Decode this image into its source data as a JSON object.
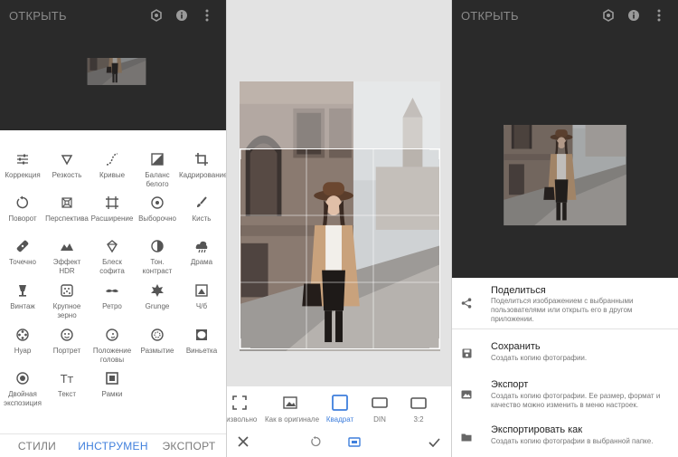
{
  "left_panel": {
    "title": "ОТКРЫТЬ",
    "tools": [
      {
        "icon": "sliders-icon",
        "label": "Коррекция"
      },
      {
        "icon": "triangle-down-icon",
        "label": "Резкость"
      },
      {
        "icon": "curves-icon",
        "label": "Кривые"
      },
      {
        "icon": "white-balance-icon",
        "label": "Баланс белого"
      },
      {
        "icon": "crop-icon",
        "label": "Кадрирование"
      },
      {
        "icon": "rotate-icon",
        "label": "Поворот"
      },
      {
        "icon": "perspective-icon",
        "label": "Перспектива"
      },
      {
        "icon": "expand-icon",
        "label": "Расширение"
      },
      {
        "icon": "selective-icon",
        "label": "Выборочно"
      },
      {
        "icon": "brush-icon",
        "label": "Кисть"
      },
      {
        "icon": "healing-icon",
        "label": "Точечно"
      },
      {
        "icon": "hdr-icon",
        "label": "Эффект HDR"
      },
      {
        "icon": "glamour-icon",
        "label": "Блеск софита"
      },
      {
        "icon": "tonal-icon",
        "label": "Тон. контраст"
      },
      {
        "icon": "drama-icon",
        "label": "Драма"
      },
      {
        "icon": "vintage-icon",
        "label": "Винтаж"
      },
      {
        "icon": "grain-icon",
        "label": "Крупное зерно"
      },
      {
        "icon": "retro-icon",
        "label": "Ретро"
      },
      {
        "icon": "grunge-icon",
        "label": "Grunge"
      },
      {
        "icon": "bw-icon",
        "label": "Ч/б"
      },
      {
        "icon": "noir-icon",
        "label": "Нуар"
      },
      {
        "icon": "portrait-icon",
        "label": "Портрет"
      },
      {
        "icon": "head-pose-icon",
        "label": "Положение головы"
      },
      {
        "icon": "blur-icon",
        "label": "Размытие"
      },
      {
        "icon": "vignette-icon",
        "label": "Виньетка"
      },
      {
        "icon": "double-exposure-icon",
        "label": "Двойная экспозиция"
      },
      {
        "icon": "text-icon",
        "label": "Текст"
      },
      {
        "icon": "frames-icon",
        "label": "Рамки"
      }
    ],
    "tabs": [
      {
        "label": "СТИЛИ",
        "active": false
      },
      {
        "label": "ИНСТРУМЕН",
        "active": true
      },
      {
        "label": "ЭКСПОРТ",
        "active": false
      }
    ]
  },
  "crop_panel": {
    "options": [
      {
        "icon": "free-crop-icon",
        "label": "оизвольно",
        "selected": false
      },
      {
        "icon": "original-icon",
        "label": "Как в оригинале",
        "selected": false
      },
      {
        "icon": "square-icon",
        "label": "Квадрат",
        "selected": true
      },
      {
        "icon": "din-icon",
        "label": "DIN",
        "selected": false
      },
      {
        "icon": "ratio-icon",
        "label": "3:2",
        "selected": false
      }
    ]
  },
  "right_panel": {
    "title": "ОТКРЫТЬ",
    "items": [
      {
        "icon": "share-icon",
        "title": "Поделиться",
        "desc": "Поделиться изображением с выбранными пользователями или открыть его в другом приложении."
      },
      {
        "icon": "save-icon",
        "title": "Сохранить",
        "desc": "Создать копию фотографии."
      },
      {
        "icon": "export-icon",
        "title": "Экспорт",
        "desc": "Создать копию фотографии. Ее размер, формат и качество можно изменить в меню настроек."
      },
      {
        "icon": "folder-icon",
        "title": "Экспортировать как",
        "desc": "Создать копию фотографии в выбранной папке."
      }
    ]
  },
  "colors": {
    "accent": "#3f7fdc",
    "dark_bg": "#2a2a2a",
    "crop_bg": "#e3e3e3"
  }
}
